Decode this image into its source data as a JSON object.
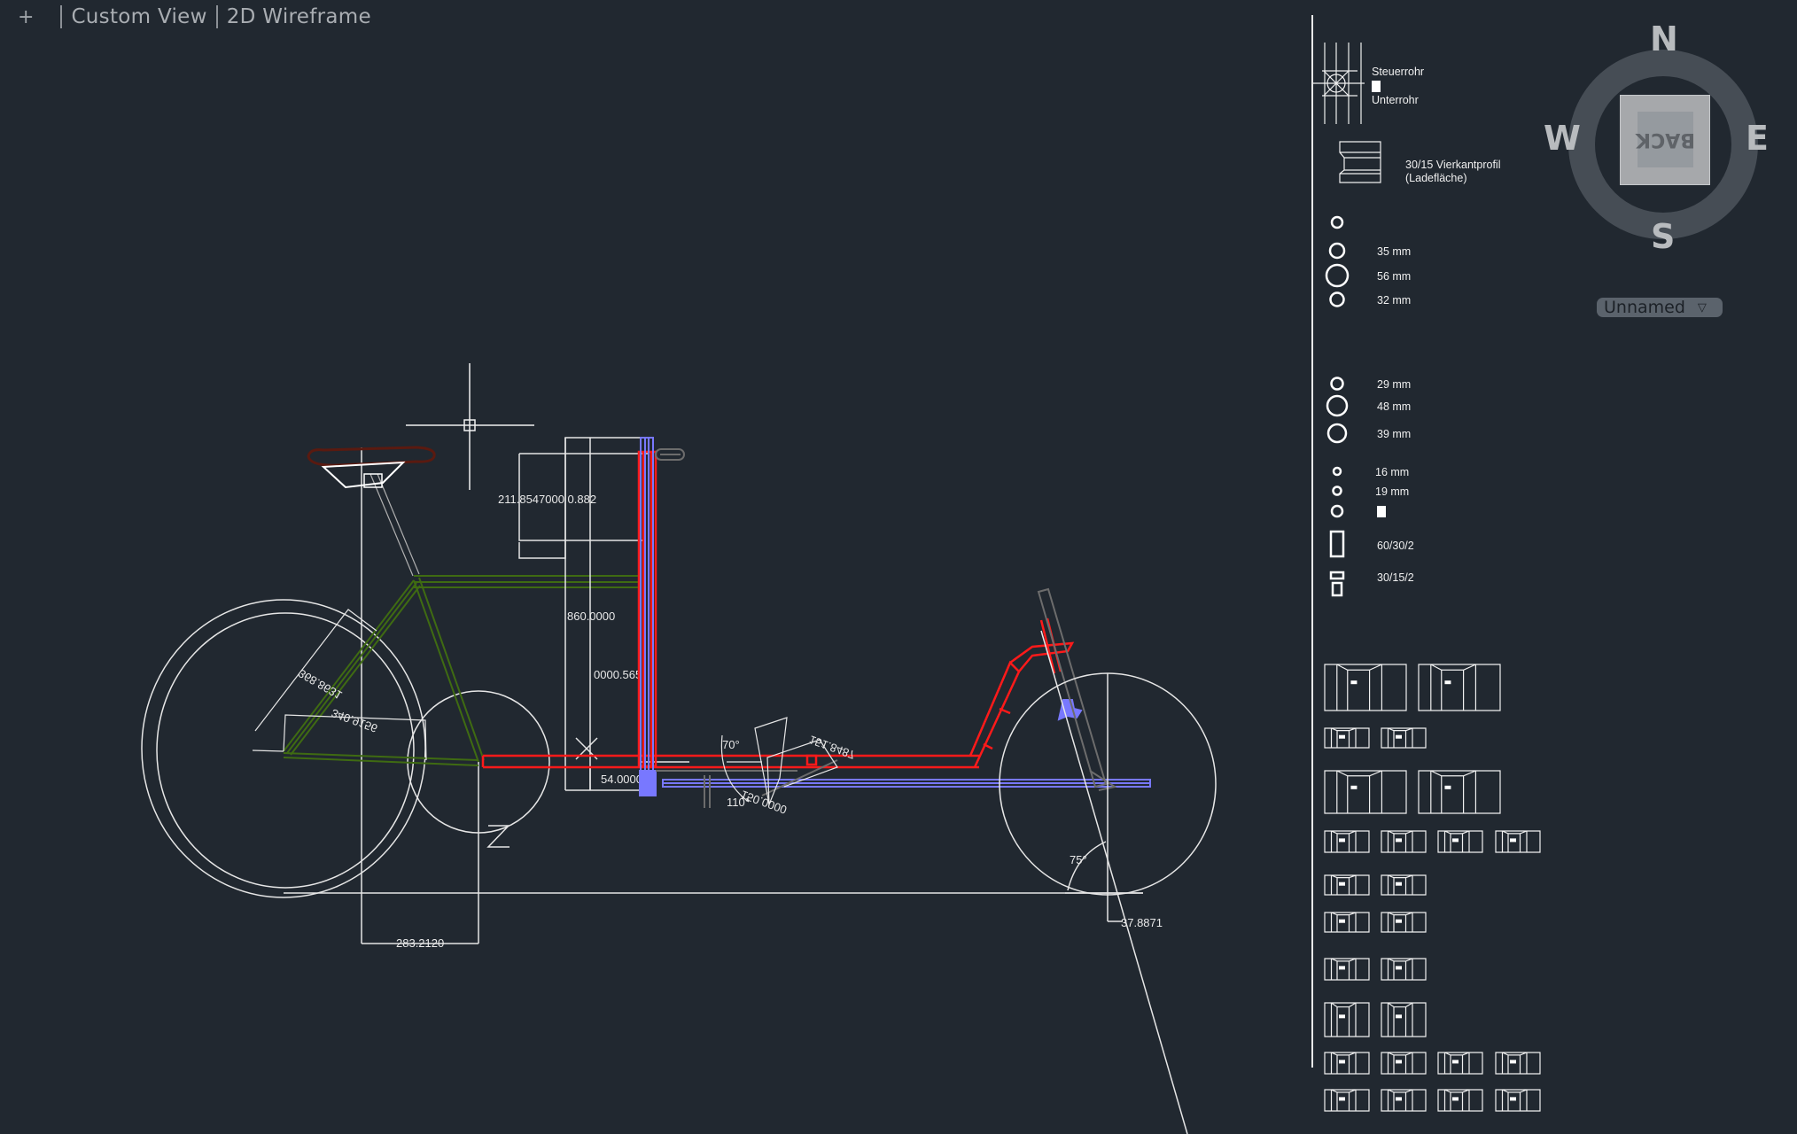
{
  "viewport": {
    "plus_label": "+",
    "view_label": "Custom View",
    "style_label": "2D Wireframe"
  },
  "viewcube": {
    "face_label": "BACK",
    "north": "N",
    "south": "S",
    "east": "E",
    "west": "W",
    "ucs_label": "Unnamed",
    "ucs_icon": "chevron-down-icon"
  },
  "layer_colors": {
    "background": "#212830",
    "geometry": "#ffffff",
    "frame_red": "#ff1a1a",
    "rear_frame_green": "#3f6b12",
    "steering_blue": "#7878ff",
    "saddle_brown": "#5a1a10",
    "auxiliary_gray": "#6c6c6c"
  },
  "dimensions": {
    "top_stack": "211.8547000 0.882",
    "height_860": "860.0000",
    "height_565": "0000.565",
    "offset_54": "54.0000",
    "wheel_radius_a": "368.8631",
    "wheel_radius_b": "340.9156",
    "chainstay": "283.2120",
    "angle_70": "70°",
    "angle_110": "110°",
    "box_151": "151.8487",
    "box_150": "150.0000",
    "head_angle": "75°",
    "trail": "37.8871"
  },
  "legend": {
    "head_tube": "Steuerrohr",
    "down_tube": "Unterrohr",
    "profile_label_1": "30/15 Vierkantprofil",
    "profile_label_2": "(Ladefläche)",
    "tubes": [
      {
        "label": ""
      },
      {
        "label": "35 mm"
      },
      {
        "label": "56 mm"
      },
      {
        "label": "32 mm"
      },
      {
        "label": "29 mm"
      },
      {
        "label": "48 mm"
      },
      {
        "label": "39 mm"
      },
      {
        "label": "16 mm"
      },
      {
        "label": "19 mm"
      }
    ],
    "rect_profile_1": "60/30/2",
    "rect_profile_2": "30/15/2"
  }
}
